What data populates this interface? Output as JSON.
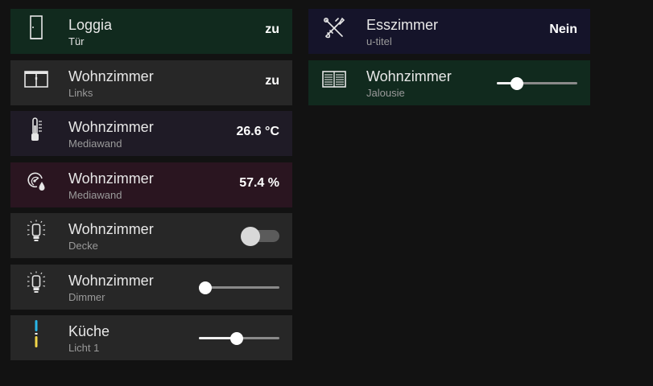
{
  "colors": {
    "page_bg": "#121212",
    "tile_default": "#272727",
    "tile_green": "#112a1e",
    "tile_purple_dark": "#1f1b26",
    "tile_wine": "#2a1520",
    "tile_navy": "#15142a"
  },
  "left": [
    {
      "id": "loggia",
      "title": "Loggia",
      "subtitle": "Tür",
      "value": "zu",
      "icon": "door-icon",
      "bg": "#112a1e",
      "control": "text"
    },
    {
      "id": "wohnzimmer-links",
      "title": "Wohnzimmer",
      "subtitle": "Links",
      "value": "zu",
      "icon": "window-icon",
      "bg": "#272727",
      "control": "text"
    },
    {
      "id": "wohnzimmer-temp",
      "title": "Wohnzimmer",
      "subtitle": "Mediawand",
      "value": "26.6 °C",
      "icon": "thermometer-icon",
      "bg": "#1f1b26",
      "control": "text"
    },
    {
      "id": "wohnzimmer-humidity",
      "title": "Wohnzimmer",
      "subtitle": "Mediawand",
      "value": "57.4 %",
      "icon": "humidity-gauge-icon",
      "bg": "#2a1520",
      "control": "text"
    },
    {
      "id": "wohnzimmer-decke",
      "title": "Wohnzimmer",
      "subtitle": "Decke",
      "icon": "light-bulb-icon",
      "bg": "#272727",
      "control": "toggle",
      "toggle_on": false
    },
    {
      "id": "wohnzimmer-dimmer",
      "title": "Wohnzimmer",
      "subtitle": "Dimmer",
      "icon": "light-bulb-icon",
      "bg": "#272727",
      "control": "slider",
      "level": 0.08
    },
    {
      "id": "kueche-licht",
      "title": "Küche",
      "subtitle": "Licht 1",
      "icon": "light-strip-icon",
      "bg": "#272727",
      "control": "slider",
      "level": 0.47
    }
  ],
  "right": [
    {
      "id": "esszimmer",
      "title": "Esszimmer",
      "subtitle": "u-titel",
      "value": "Nein",
      "icon": "tools-icon",
      "bg": "#15142a",
      "control": "text"
    },
    {
      "id": "wohnzimmer-jalousie",
      "title": "Wohnzimmer",
      "subtitle": "Jalousie",
      "icon": "blinds-icon",
      "bg": "#112a1e",
      "control": "slider",
      "level": 0.25
    }
  ]
}
